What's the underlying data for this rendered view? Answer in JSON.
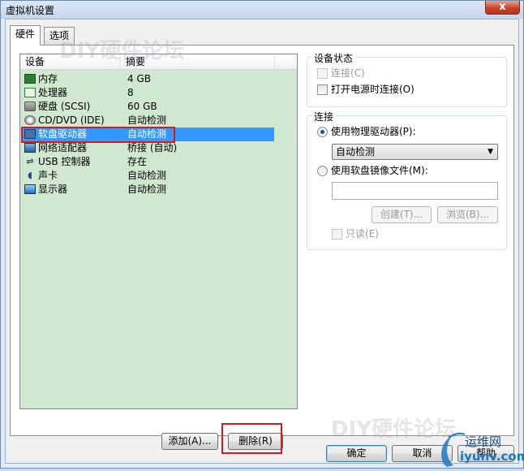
{
  "window": {
    "title": "虚拟机设置",
    "close_glyph": "x"
  },
  "tabs": [
    {
      "label": "硬件",
      "active": true
    },
    {
      "label": "选项",
      "active": false
    }
  ],
  "device_list": {
    "columns": [
      "设备",
      "摘要"
    ],
    "rows": [
      {
        "icon": "memory-icon",
        "name": "内存",
        "summary": "4 GB"
      },
      {
        "icon": "cpu-icon",
        "name": "处理器",
        "summary": "8"
      },
      {
        "icon": "hard-disk-icon",
        "name": "硬盘 (SCSI)",
        "summary": "60 GB"
      },
      {
        "icon": "cd-dvd-icon",
        "name": "CD/DVD (IDE)",
        "summary": "自动检测"
      },
      {
        "icon": "floppy-icon",
        "name": "软盘驱动器",
        "summary": "自动检测",
        "selected": true
      },
      {
        "icon": "network-adapter-icon",
        "name": "网络适配器",
        "summary": "桥接 (自动)"
      },
      {
        "icon": "usb-icon",
        "name": "USB 控制器",
        "summary": "存在"
      },
      {
        "icon": "sound-card-icon",
        "name": "声卡",
        "summary": "自动检测"
      },
      {
        "icon": "display-icon",
        "name": "显示器",
        "summary": "自动检测"
      }
    ]
  },
  "list_buttons": {
    "add": "添加(A)...",
    "remove": "删除(R)"
  },
  "device_status": {
    "title": "设备状态",
    "connected": {
      "label": "连接(C)",
      "checked": false,
      "enabled": false
    },
    "connect_on_power_on": {
      "label": "打开电源时连接(O)",
      "checked": false,
      "enabled": true
    }
  },
  "connection": {
    "title": "连接",
    "use_physical": {
      "label": "使用物理驱动器(P):",
      "checked": true
    },
    "physical_select": {
      "value": "自动检测"
    },
    "use_image": {
      "label": "使用软盘镜像文件(M):",
      "checked": false
    },
    "image_path": {
      "value": ""
    },
    "create_button": "创建(T)...",
    "browse_button": "浏览(B)...",
    "read_only": {
      "label": "只读(E)",
      "checked": false,
      "enabled": false
    }
  },
  "dialog_buttons": {
    "ok": "确定",
    "cancel": "取消",
    "help": "帮助"
  },
  "watermarks": [
    "DIY硬件论坛",
    "DIY硬件论坛"
  ],
  "brand": {
    "cn": "运维网",
    "en": "iyunv.com"
  },
  "colors": {
    "selection": "#3399ff",
    "highlight_box": "#d51c1c",
    "list_bg": "#cfe8cf"
  }
}
